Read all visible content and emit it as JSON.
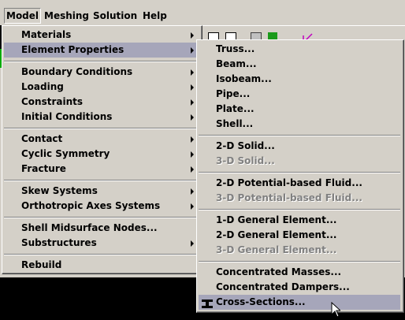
{
  "menubar": {
    "items": [
      {
        "label": "Model"
      },
      {
        "label": "Meshing"
      },
      {
        "label": "Solution"
      },
      {
        "label": "Help"
      }
    ]
  },
  "model_menu": {
    "items": [
      {
        "label": "Materials"
      },
      {
        "label": "Element Properties"
      },
      {
        "label": "Boundary Conditions"
      },
      {
        "label": "Loading"
      },
      {
        "label": "Constraints"
      },
      {
        "label": "Initial Conditions"
      },
      {
        "label": "Contact"
      },
      {
        "label": "Cyclic Symmetry"
      },
      {
        "label": "Fracture"
      },
      {
        "label": "Skew Systems"
      },
      {
        "label": "Orthotropic Axes Systems"
      },
      {
        "label": "Shell Midsurface Nodes..."
      },
      {
        "label": "Substructures"
      },
      {
        "label": "Rebuild"
      }
    ]
  },
  "element_properties_menu": {
    "items": [
      {
        "label": "Truss..."
      },
      {
        "label": "Beam..."
      },
      {
        "label": "Isobeam..."
      },
      {
        "label": "Pipe..."
      },
      {
        "label": "Plate..."
      },
      {
        "label": "Shell..."
      },
      {
        "label": "2-D Solid..."
      },
      {
        "label": "3-D Solid..."
      },
      {
        "label": "2-D Potential-based Fluid..."
      },
      {
        "label": "3-D Potential-based Fluid..."
      },
      {
        "label": "1-D General Element..."
      },
      {
        "label": "2-D General Element..."
      },
      {
        "label": "3-D General Element..."
      },
      {
        "label": "Concentrated Masses..."
      },
      {
        "label": "Concentrated Dampers..."
      },
      {
        "label": "Cross-Sections..."
      }
    ]
  },
  "colors": {
    "menu_bg": "#d4d0c8",
    "highlight": "#a6a6ba",
    "disabled": "#808080"
  }
}
